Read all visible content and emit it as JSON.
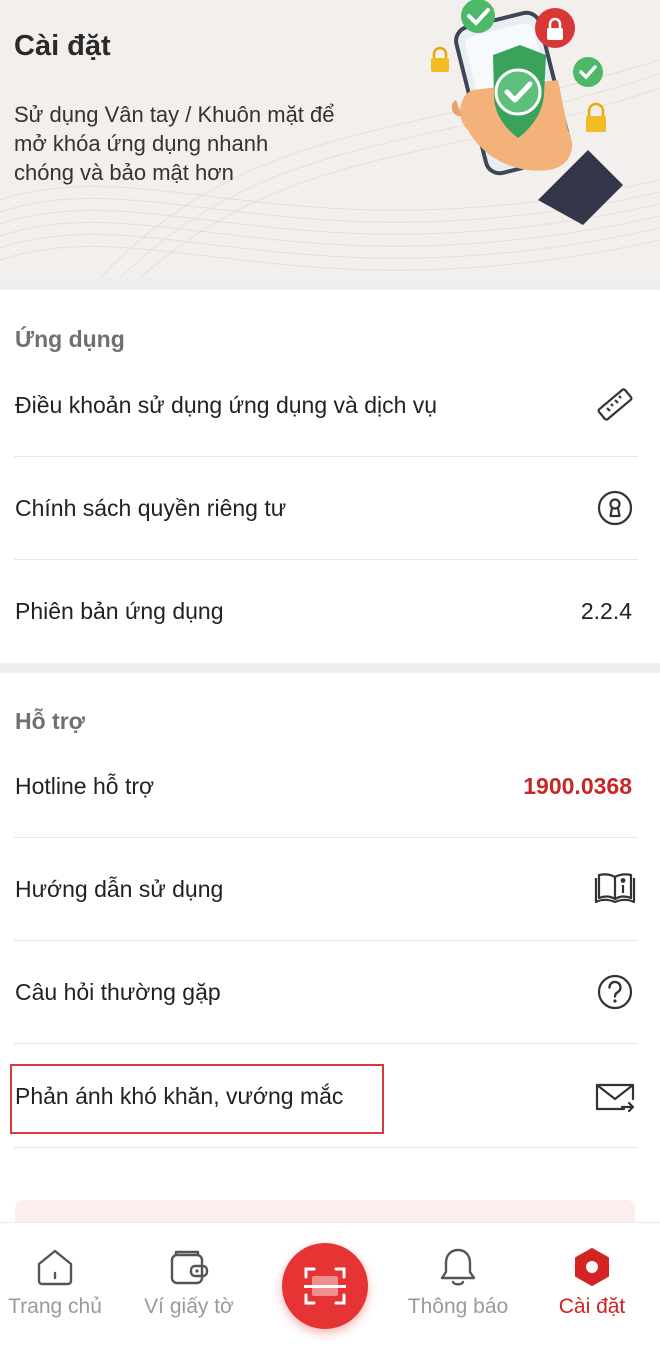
{
  "header": {
    "title": "Cài đặt",
    "subtitle": "Sử dụng Vân tay / Khuôn mặt để\nmở  khóa ứng dụng nhanh\nchóng và bảo mật hơn"
  },
  "app_section": {
    "title": "Ứng dụng",
    "items": [
      {
        "label": "Điều khoản sử dụng ứng dụng và dịch vụ",
        "icon": "ruler-icon"
      },
      {
        "label": "Chính sách quyền riêng tư",
        "icon": "keyhole-icon"
      },
      {
        "label": "Phiên bản ứng dụng",
        "value": "2.2.4"
      }
    ]
  },
  "support_section": {
    "title": "Hỗ trợ",
    "items": [
      {
        "label": "Hotline hỗ trợ",
        "value": "1900.0368",
        "value_color": "#c62828"
      },
      {
        "label": "Hướng dẫn sử dụng",
        "icon": "book-info-icon"
      },
      {
        "label": "Câu hỏi thường gặp",
        "icon": "question-circle-icon"
      },
      {
        "label": "Phản ánh khó khăn, vướng mắc",
        "icon": "mail-send-icon",
        "highlighted": true
      }
    ]
  },
  "bottom_nav": {
    "items": [
      {
        "label": "Trang chủ",
        "icon": "home-icon",
        "active": false
      },
      {
        "label": "Ví giấy tờ",
        "icon": "wallet-icon",
        "active": false
      },
      {
        "label": "",
        "icon": "scan-icon",
        "active": false
      },
      {
        "label": "Thông báo",
        "icon": "bell-icon",
        "active": false
      },
      {
        "label": "Cài đặt",
        "icon": "settings-hex-icon",
        "active": true
      }
    ]
  },
  "colors": {
    "accent": "#d32323",
    "header_bg": "#f3efec",
    "hotline": "#c62828"
  }
}
